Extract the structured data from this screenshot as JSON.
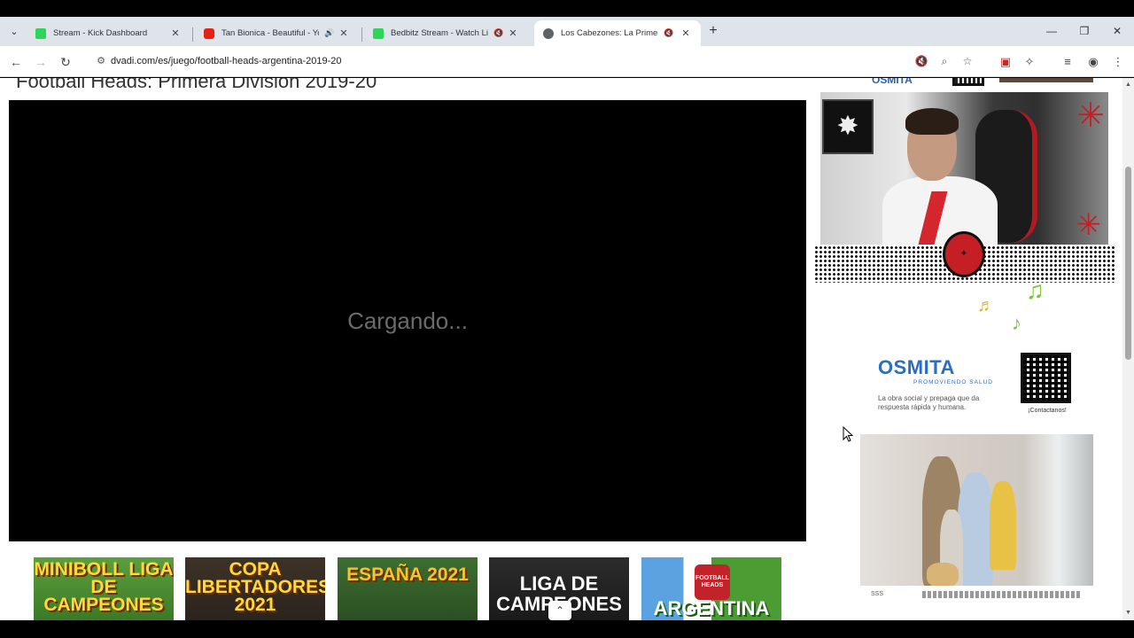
{
  "browser": {
    "tabs": [
      {
        "title": "Stream - Kick Dashboard",
        "favicon_color": "#2bd65a",
        "active": false,
        "audio": ""
      },
      {
        "title": "Tan Bionica - Beautiful - You",
        "favicon_color": "#e62117",
        "active": false,
        "audio": "🔊"
      },
      {
        "title": "Bedbitz Stream - Watch Liv",
        "favicon_color": "#2bd65a",
        "active": false,
        "audio": "🔇"
      },
      {
        "title": "Los Cabezones: La Primera",
        "favicon_color": "#5f6368",
        "active": true,
        "audio": "🔇"
      }
    ],
    "url": "dvadi.com/es/juego/football-heads-argentina-2019-20"
  },
  "page": {
    "title": "Football Heads: Primera Division 2019-20",
    "loading_text": "Cargando...",
    "related_games": [
      {
        "label": "MINIBOLL LIGA DE CAMPEONES"
      },
      {
        "label": "COPA LIBERTADORES 2021"
      },
      {
        "label": "ESPAÑA 2021"
      },
      {
        "label": "LIGA DE CAMPEONES"
      },
      {
        "label": "ARGENTINA",
        "badge": "FOOTBALL HEADS"
      }
    ]
  },
  "ads": {
    "top_brand": "OSMITA",
    "brand": "OSMITA",
    "tagline": "PROMOVIENDO SALUD",
    "description": "La obra social y prepaga que da respuesta rápida y humana.",
    "qr_label": "¡Contactanos!",
    "photo_logo": "SSS"
  }
}
